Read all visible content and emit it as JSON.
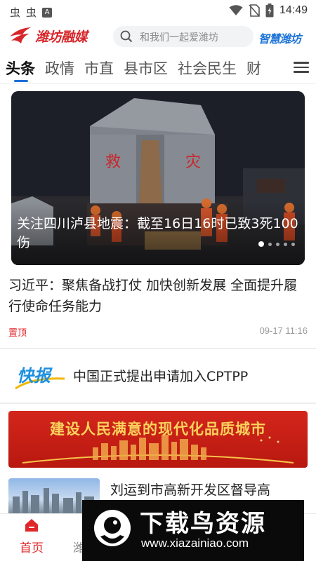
{
  "status_bar": {
    "left_icons": [
      "虫",
      "虫",
      "A"
    ],
    "time": "14:49",
    "icons": [
      "wifi-icon",
      "no-sim-icon",
      "battery-icon"
    ]
  },
  "header": {
    "app_name": "潍坊融媒",
    "search_placeholder": "和我们一起爱潍坊",
    "brand": "智慧潍坊"
  },
  "tabs": [
    {
      "label": "头条",
      "active": true
    },
    {
      "label": "政情",
      "active": false
    },
    {
      "label": "市直",
      "active": false
    },
    {
      "label": "县市区",
      "active": false
    },
    {
      "label": "社会民生",
      "active": false
    },
    {
      "label": "财",
      "active": false
    }
  ],
  "banner": {
    "title": "关注四川泸县地震：截至16日16时已致3死100伤",
    "tent_text_left": "救",
    "tent_text_right": "灾",
    "dot_count": 5,
    "active_dot": 0
  },
  "article1": {
    "title": "习近平：聚焦备战打仗 加快创新发展 全面提升履行使命任务能力",
    "tag": "置顶",
    "time": "09-17 11:16"
  },
  "kuaibao": {
    "logo_text": "快报",
    "text": "中国正式提出申请加入CPTPP"
  },
  "promo": {
    "title": "建设人民满意的现代化品质城市"
  },
  "article2": {
    "title": "刘运到市高新开发区督导高"
  },
  "bottom_nav": {
    "home_label": "首页",
    "second_label_partial": "潍"
  },
  "watermark": {
    "title": "下载鸟资源",
    "url": "www.xiazainiao.com"
  },
  "colors": {
    "brand_red": "#d7262b",
    "brand_blue": "#1d74d8",
    "tab_indicator": "#1d6fd8",
    "promo_gold": "#fbd25c"
  }
}
